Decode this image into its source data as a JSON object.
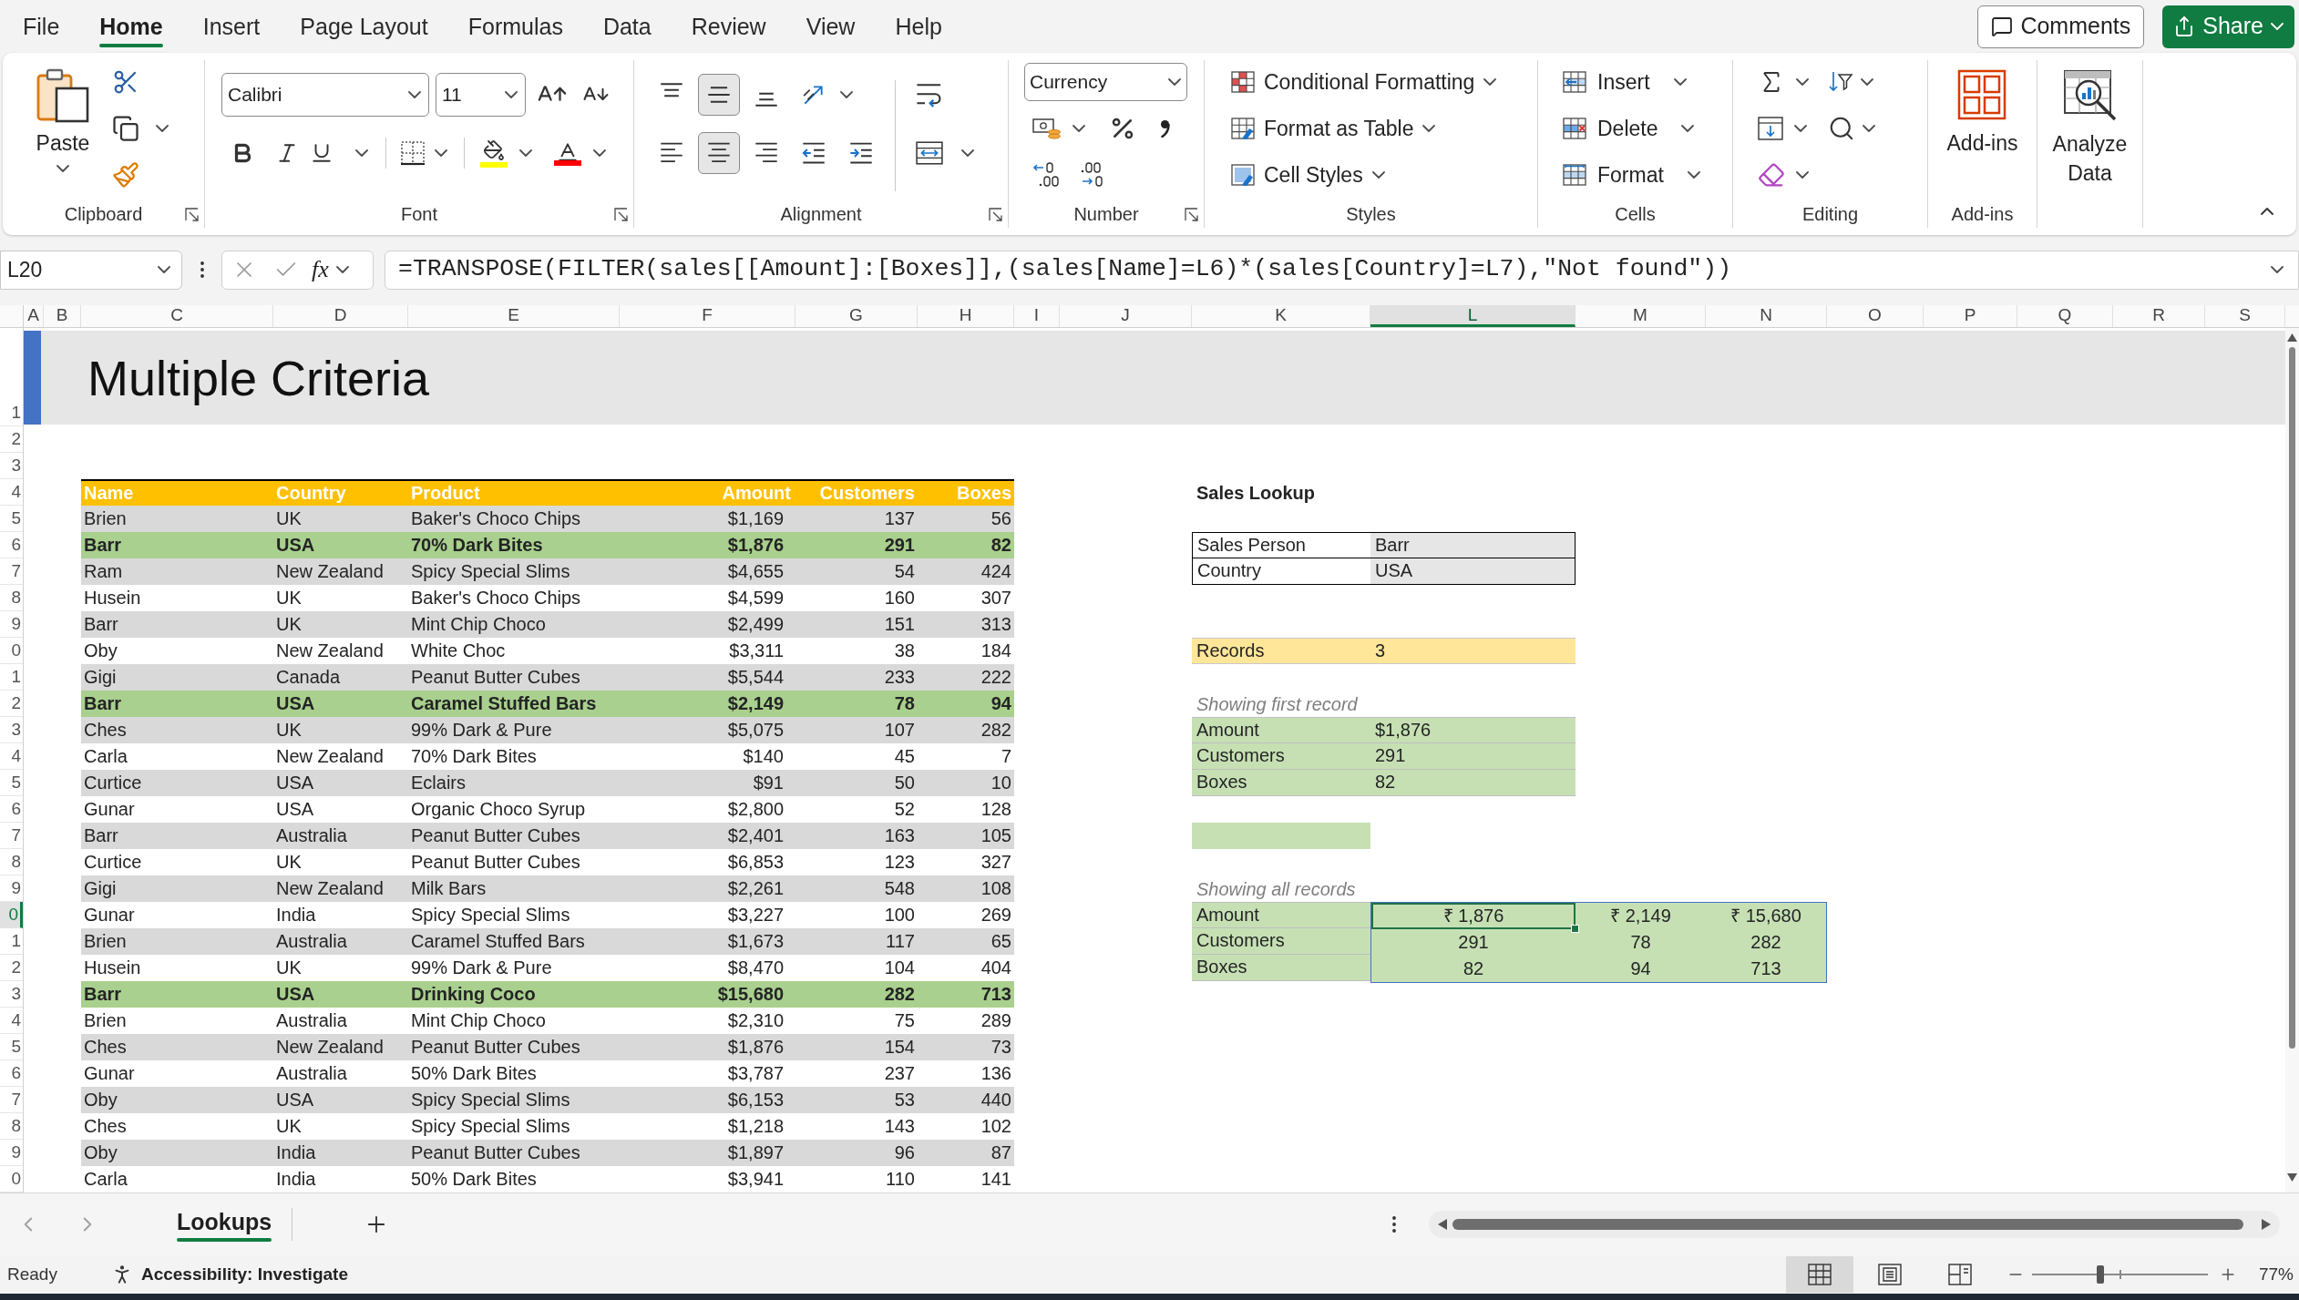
{
  "menu_tabs": [
    {
      "label": "File",
      "selected": false
    },
    {
      "label": "Home",
      "selected": true
    },
    {
      "label": "Insert",
      "selected": false
    },
    {
      "label": "Page Layout",
      "selected": false
    },
    {
      "label": "Formulas",
      "selected": false
    },
    {
      "label": "Data",
      "selected": false
    },
    {
      "label": "Review",
      "selected": false
    },
    {
      "label": "View",
      "selected": false
    },
    {
      "label": "Help",
      "selected": false
    }
  ],
  "header_buttons": [
    {
      "kind": "comments",
      "label": "Comments"
    },
    {
      "kind": "share",
      "label": "Share"
    }
  ],
  "ribbon": {
    "clipboard": {
      "label": "Clipboard",
      "paste": "Paste"
    },
    "font": {
      "label": "Font",
      "font_name": "Calibri",
      "font_size": "11"
    },
    "alignment": {
      "label": "Alignment",
      "vertical": [
        {
          "kind": "top",
          "on": false
        },
        {
          "kind": "middle",
          "on": true
        },
        {
          "kind": "bottom",
          "on": false
        }
      ],
      "horizontal": [
        {
          "kind": "left",
          "on": false
        },
        {
          "kind": "center",
          "on": true
        },
        {
          "kind": "right",
          "on": false
        }
      ]
    },
    "number": {
      "label": "Number",
      "format": "Currency"
    },
    "styles": {
      "label": "Styles",
      "items": [
        {
          "kind": "conditional",
          "label": "Conditional Formatting"
        },
        {
          "kind": "table",
          "label": "Format as Table"
        },
        {
          "kind": "cell",
          "label": "Cell Styles"
        }
      ]
    },
    "cells": {
      "label": "Cells",
      "items": [
        {
          "kind": "insert",
          "label": "Insert"
        },
        {
          "kind": "delete",
          "label": "Delete"
        },
        {
          "kind": "format",
          "label": "Format"
        }
      ]
    },
    "editing": {
      "label": "Editing"
    },
    "addins": {
      "label": "Add-ins",
      "button": "Add-ins"
    },
    "analyze": {
      "button": "Analyze Data"
    }
  },
  "formula_bar": {
    "name_box": "L20",
    "function_button": "fx",
    "formula": "=TRANSPOSE(FILTER(sales[[Amount]:[Boxes]],(sales[Name]=L6)*(sales[Country]=L7),\"Not found\"))"
  },
  "column_headers": [
    {
      "label": "A",
      "selected": false
    },
    {
      "label": "B",
      "selected": false
    },
    {
      "label": "C",
      "selected": false
    },
    {
      "label": "D",
      "selected": false
    },
    {
      "label": "E",
      "selected": false
    },
    {
      "label": "F",
      "selected": false
    },
    {
      "label": "G",
      "selected": false
    },
    {
      "label": "H",
      "selected": false
    },
    {
      "label": "I",
      "selected": false
    },
    {
      "label": "J",
      "selected": false
    },
    {
      "label": "K",
      "selected": false
    },
    {
      "label": "L",
      "selected": true
    },
    {
      "label": "M",
      "selected": false
    },
    {
      "label": "N",
      "selected": false
    },
    {
      "label": "O",
      "selected": false
    },
    {
      "label": "P",
      "selected": false
    },
    {
      "label": "Q",
      "selected": false
    },
    {
      "label": "R",
      "selected": false
    },
    {
      "label": "S",
      "selected": false
    }
  ],
  "row_headers": [
    {
      "label": "1",
      "selected": false
    },
    {
      "label": "2",
      "selected": false
    },
    {
      "label": "3",
      "selected": false
    },
    {
      "label": "4",
      "selected": false
    },
    {
      "label": "5",
      "selected": false
    },
    {
      "label": "6",
      "selected": false
    },
    {
      "label": "7",
      "selected": false
    },
    {
      "label": "8",
      "selected": false
    },
    {
      "label": "9",
      "selected": false
    },
    {
      "label": "0",
      "selected": false
    },
    {
      "label": "1",
      "selected": false
    },
    {
      "label": "2",
      "selected": false
    },
    {
      "label": "3",
      "selected": false
    },
    {
      "label": "4",
      "selected": false
    },
    {
      "label": "5",
      "selected": false
    },
    {
      "label": "6",
      "selected": false
    },
    {
      "label": "7",
      "selected": false
    },
    {
      "label": "8",
      "selected": false
    },
    {
      "label": "9",
      "selected": false
    },
    {
      "label": "0",
      "selected": true
    },
    {
      "label": "1",
      "selected": false
    },
    {
      "label": "2",
      "selected": false
    },
    {
      "label": "3",
      "selected": false
    },
    {
      "label": "4",
      "selected": false
    },
    {
      "label": "5",
      "selected": false
    },
    {
      "label": "6",
      "selected": false
    },
    {
      "label": "7",
      "selected": false
    },
    {
      "label": "8",
      "selected": false
    },
    {
      "label": "9",
      "selected": false
    },
    {
      "label": "0",
      "selected": false
    }
  ],
  "title": "Multiple Criteria",
  "table": {
    "columns": [
      "Name",
      "Country",
      "Product",
      "Amount",
      "Customers",
      "Boxes"
    ],
    "rows": [
      {
        "cells": [
          "Brien",
          "UK",
          "Baker's Choco Chips",
          "$1,169",
          "137",
          "56"
        ],
        "highlighted": false
      },
      {
        "cells": [
          "Barr",
          "USA",
          "70% Dark Bites",
          "$1,876",
          "291",
          "82"
        ],
        "highlighted": true
      },
      {
        "cells": [
          "Ram",
          "New Zealand",
          "Spicy Special Slims",
          "$4,655",
          "54",
          "424"
        ],
        "highlighted": false
      },
      {
        "cells": [
          "Husein",
          "UK",
          "Baker's Choco Chips",
          "$4,599",
          "160",
          "307"
        ],
        "highlighted": false
      },
      {
        "cells": [
          "Barr",
          "UK",
          "Mint Chip Choco",
          "$2,499",
          "151",
          "313"
        ],
        "highlighted": false
      },
      {
        "cells": [
          "Oby",
          "New Zealand",
          "White Choc",
          "$3,311",
          "38",
          "184"
        ],
        "highlighted": false
      },
      {
        "cells": [
          "Gigi",
          "Canada",
          "Peanut Butter Cubes",
          "$5,544",
          "233",
          "222"
        ],
        "highlighted": false
      },
      {
        "cells": [
          "Barr",
          "USA",
          "Caramel Stuffed Bars",
          "$2,149",
          "78",
          "94"
        ],
        "highlighted": true
      },
      {
        "cells": [
          "Ches",
          "UK",
          "99% Dark & Pure",
          "$5,075",
          "107",
          "282"
        ],
        "highlighted": false
      },
      {
        "cells": [
          "Carla",
          "New Zealand",
          "70% Dark Bites",
          "$140",
          "45",
          "7"
        ],
        "highlighted": false
      },
      {
        "cells": [
          "Curtice",
          "USA",
          "Eclairs",
          "$91",
          "50",
          "10"
        ],
        "highlighted": false
      },
      {
        "cells": [
          "Gunar",
          "USA",
          "Organic Choco Syrup",
          "$2,800",
          "52",
          "128"
        ],
        "highlighted": false
      },
      {
        "cells": [
          "Barr",
          "Australia",
          "Peanut Butter Cubes",
          "$2,401",
          "163",
          "105"
        ],
        "highlighted": false
      },
      {
        "cells": [
          "Curtice",
          "UK",
          "Peanut Butter Cubes",
          "$6,853",
          "123",
          "327"
        ],
        "highlighted": false
      },
      {
        "cells": [
          "Gigi",
          "New Zealand",
          "Milk Bars",
          "$2,261",
          "548",
          "108"
        ],
        "highlighted": false
      },
      {
        "cells": [
          "Gunar",
          "India",
          "Spicy Special Slims",
          "$3,227",
          "100",
          "269"
        ],
        "highlighted": false
      },
      {
        "cells": [
          "Brien",
          "Australia",
          "Caramel Stuffed Bars",
          "$1,673",
          "117",
          "65"
        ],
        "highlighted": false
      },
      {
        "cells": [
          "Husein",
          "UK",
          "99% Dark & Pure",
          "$8,470",
          "104",
          "404"
        ],
        "highlighted": false
      },
      {
        "cells": [
          "Barr",
          "USA",
          "Drinking Coco",
          "$15,680",
          "282",
          "713"
        ],
        "highlighted": true
      },
      {
        "cells": [
          "Brien",
          "Australia",
          "Mint Chip Choco",
          "$2,310",
          "75",
          "289"
        ],
        "highlighted": false
      },
      {
        "cells": [
          "Ches",
          "New Zealand",
          "Peanut Butter Cubes",
          "$1,876",
          "154",
          "73"
        ],
        "highlighted": false
      },
      {
        "cells": [
          "Gunar",
          "Australia",
          "50% Dark Bites",
          "$3,787",
          "237",
          "136"
        ],
        "highlighted": false
      },
      {
        "cells": [
          "Oby",
          "USA",
          "Spicy Special Slims",
          "$6,153",
          "53",
          "440"
        ],
        "highlighted": false
      },
      {
        "cells": [
          "Ches",
          "UK",
          "Spicy Special Slims",
          "$1,218",
          "143",
          "102"
        ],
        "highlighted": false
      },
      {
        "cells": [
          "Oby",
          "India",
          "Peanut Butter Cubes",
          "$1,897",
          "96",
          "87"
        ],
        "highlighted": false
      },
      {
        "cells": [
          "Carla",
          "India",
          "50% Dark Bites",
          "$3,941",
          "110",
          "141"
        ],
        "highlighted": false
      }
    ]
  },
  "lookup": {
    "title": "Sales Lookup",
    "criteria": [
      {
        "label": "Sales Person",
        "value": "Barr"
      },
      {
        "label": "Country",
        "value": "USA"
      }
    ],
    "records": {
      "label": "Records",
      "value": "3"
    },
    "first_record": {
      "caption": "Showing first record",
      "rows": [
        {
          "label": "Amount",
          "value": "$1,876"
        },
        {
          "label": "Customers",
          "value": "291"
        },
        {
          "label": "Boxes",
          "value": "82"
        }
      ]
    },
    "all_records": {
      "caption": "Showing all records",
      "rows": [
        {
          "label": "Amount",
          "values": [
            {
              "text": "₹ 1,876",
              "selected": true
            },
            {
              "text": "₹ 2,149",
              "selected": false
            },
            {
              "text": "₹ 15,680",
              "selected": false
            }
          ]
        },
        {
          "label": "Customers",
          "values": [
            {
              "text": "291",
              "selected": false
            },
            {
              "text": "78",
              "selected": false
            },
            {
              "text": "282",
              "selected": false
            }
          ]
        },
        {
          "label": "Boxes",
          "values": [
            {
              "text": "82",
              "selected": false
            },
            {
              "text": "94",
              "selected": false
            },
            {
              "text": "713",
              "selected": false
            }
          ]
        }
      ]
    }
  },
  "sheet_tabs": [
    {
      "label": "Lookups",
      "selected": true
    }
  ],
  "status_bar": {
    "status": "Ready",
    "accessibility": "Accessibility: Investigate",
    "views": [
      {
        "kind": "normal",
        "selected": true
      },
      {
        "kind": "page_layout",
        "selected": false
      },
      {
        "kind": "page_break",
        "selected": false
      }
    ],
    "zoom": {
      "level": 0.39,
      "reading": "77%"
    }
  }
}
